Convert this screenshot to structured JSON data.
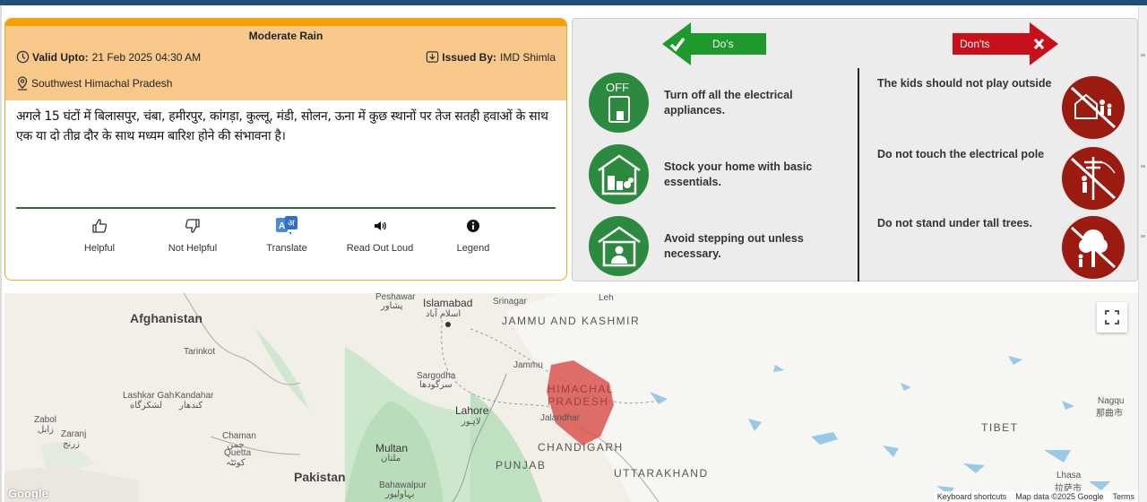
{
  "alert": {
    "title": "Moderate Rain",
    "valid_label": "Valid Upto:",
    "valid_value": "21 Feb 2025 04:30 AM",
    "issued_label": "Issued By:",
    "issued_value": "IMD Shimla",
    "region": "Southwest Himachal Pradesh",
    "message": "अगले 15 घंटों में बिलासपुर, चंबा, हमीरपुर, कांगड़ा, कुल्लू, मंडी, सोलन, ऊना में कुछ स्थानों पर तेज सतही हवाओं के साथ एक या दो तीव्र दौर के साथ मध्यम बारिश होने की संभावना है।",
    "colors": {
      "header": "#f9c98b",
      "border": "#f5a623",
      "divider": "#2e6b3a"
    }
  },
  "actions": [
    {
      "label": "Helpful",
      "icon": "thumbs-up-icon"
    },
    {
      "label": "Not Helpful",
      "icon": "thumbs-down-icon"
    },
    {
      "label": "Translate",
      "icon": "translate-icon"
    },
    {
      "label": "Read Out Loud",
      "icon": "speaker-icon"
    },
    {
      "label": "Legend",
      "icon": "info-icon"
    }
  ],
  "dos_donts": {
    "dos_label": "Do's",
    "donts_label": "Don'ts",
    "dos": [
      {
        "text": "Turn off all the electrical appliances.",
        "icon": "switch-off-icon",
        "icon_text": "OFF"
      },
      {
        "text": "Stock your home with basic essentials.",
        "icon": "home-supplies-icon"
      },
      {
        "text": "Avoid stepping out unless necessary.",
        "icon": "stay-home-icon"
      }
    ],
    "donts": [
      {
        "text": "The kids should not play outside",
        "icon": "no-kids-outside-icon"
      },
      {
        "text": "Do not touch the electrical pole",
        "icon": "no-electric-pole-icon"
      },
      {
        "text": "Do not stand under tall trees.",
        "icon": "no-tree-icon"
      }
    ],
    "colors": {
      "do": "#1e9a2c",
      "dont": "#c8101a",
      "dont_circle": "#9b1b10",
      "do_circle": "#2b8a3e"
    }
  },
  "map": {
    "countries": [
      "Afghanistan",
      "Pakistan"
    ],
    "states": [
      "JAMMU AND KASHMIR",
      "HIMACHAL PRADESH",
      "PUNJAB",
      "CHANDIGARH",
      "UTTARAKHAND",
      "TIBET"
    ],
    "cities": [
      "Peshawar",
      "پشاور",
      "Islamabad",
      "اسلام آباد",
      "Srinagar",
      "Leh",
      "Jammu",
      "Sargodha",
      "سرگودھا",
      "Lahore",
      "لاہور",
      "Jalandhar",
      "Multan",
      "ملتان",
      "Bahawalpur",
      "بہاولپور",
      "Tarinkot",
      "Lashkar Gah",
      "لشکرگاه",
      "Kandahar",
      "کندهار",
      "Zabol",
      "زابل",
      "Zaranj",
      "زرنج",
      "Chaman",
      "چمن",
      "Quetta",
      "کوئٹہ",
      "Nagqu",
      "那曲市",
      "Lhasa",
      "拉萨市"
    ],
    "footer": [
      "Keyboard shortcuts",
      "Map data ©2025 Google",
      "Terms"
    ],
    "logo_text": "Google",
    "highlight_color": "#d9534f"
  }
}
